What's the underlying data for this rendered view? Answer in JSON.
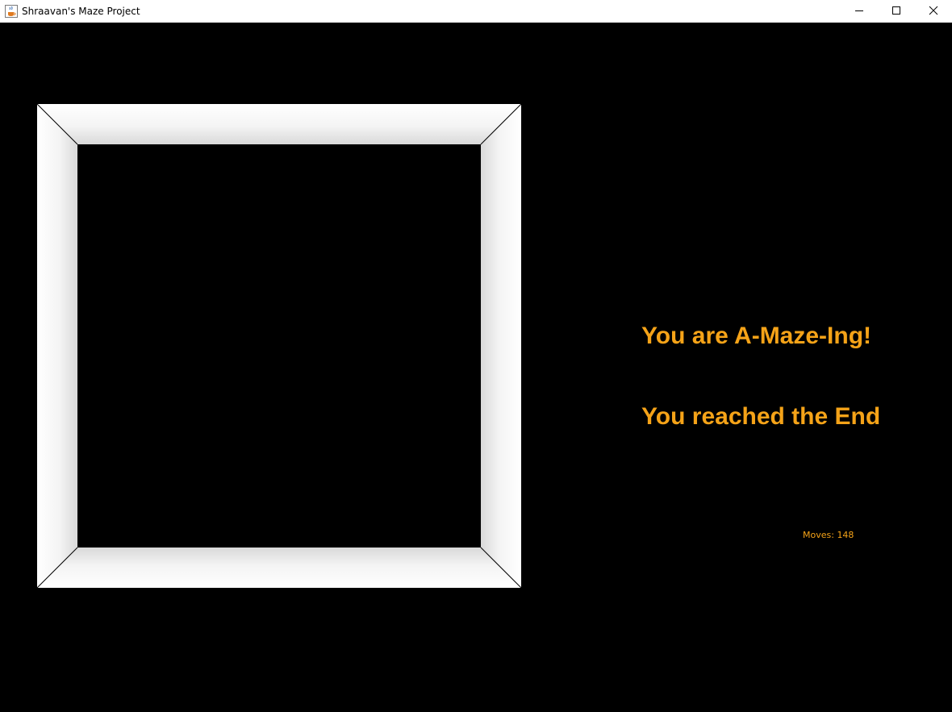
{
  "window": {
    "title": "Shraavan's Maze Project",
    "icon": "java-cup-icon",
    "controls": {
      "minimize": "minimize-icon",
      "maximize": "maximize-icon",
      "close": "close-icon"
    }
  },
  "game": {
    "message_line1": "You are A-Maze-Ing!",
    "message_line2": "You reached the End",
    "moves_label": "Moves:",
    "moves_count": "148",
    "colors": {
      "background": "#000000",
      "text": "#f5a318",
      "wall": "#ffffff",
      "wall_shade": "#d8d8d8"
    }
  }
}
